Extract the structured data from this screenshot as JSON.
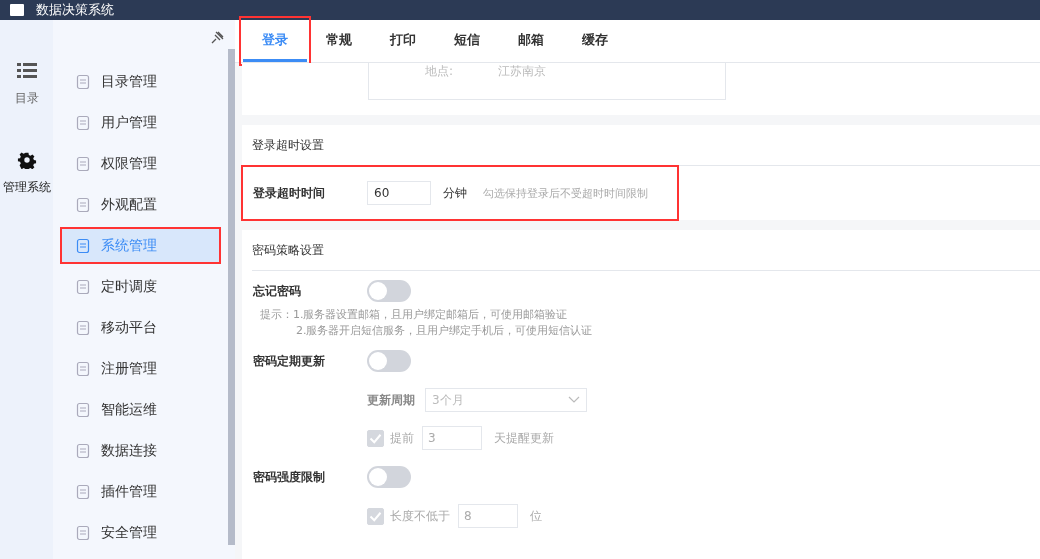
{
  "header": {
    "title": "数据决策系统"
  },
  "rail": [
    {
      "label": "目录",
      "kind": "list",
      "selected": false
    },
    {
      "label": "管理系统",
      "kind": "gear",
      "selected": true
    }
  ],
  "sidebar": {
    "items": [
      {
        "label": "目录管理",
        "selected": false
      },
      {
        "label": "用户管理",
        "selected": false
      },
      {
        "label": "权限管理",
        "selected": false
      },
      {
        "label": "外观配置",
        "selected": false
      },
      {
        "label": "系统管理",
        "selected": true
      },
      {
        "label": "定时调度",
        "selected": false
      },
      {
        "label": "移动平台",
        "selected": false
      },
      {
        "label": "注册管理",
        "selected": false
      },
      {
        "label": "智能运维",
        "selected": false
      },
      {
        "label": "数据连接",
        "selected": false
      },
      {
        "label": "插件管理",
        "selected": false
      },
      {
        "label": "安全管理",
        "selected": false
      }
    ]
  },
  "tabs": [
    {
      "label": "登录",
      "selected": true
    },
    {
      "label": "常规",
      "selected": false
    },
    {
      "label": "打印",
      "selected": false
    },
    {
      "label": "短信",
      "selected": false
    },
    {
      "label": "邮箱",
      "selected": false
    },
    {
      "label": "缓存",
      "selected": false
    }
  ],
  "info_card": {
    "label": "地点:",
    "value": "江苏南京"
  },
  "timeout": {
    "heading": "登录超时设置",
    "label": "登录超时时间",
    "value": "60",
    "unit": "分钟",
    "hint": "勾选保持登录后不受超时时间限制"
  },
  "password": {
    "heading": "密码策略设置",
    "forget": {
      "label": "忘记密码",
      "on": false
    },
    "tips": [
      "提示：1.服务器设置邮箱，且用户绑定邮箱后，可使用邮箱验证",
      "2.服务器开启短信服务，且用户绑定手机后，可使用短信认证"
    ],
    "update": {
      "label": "密码定期更新",
      "on": false,
      "period_label": "更新周期",
      "period_value": "3个月",
      "remind_checked": true,
      "remind_label": "提前",
      "remind_value": "3",
      "remind_suffix": "天提醒更新"
    },
    "strength": {
      "label": "密码强度限制",
      "on": false,
      "length_checked": true,
      "length_label": "长度不低于",
      "length_value": "8",
      "length_suffix": "位"
    }
  }
}
